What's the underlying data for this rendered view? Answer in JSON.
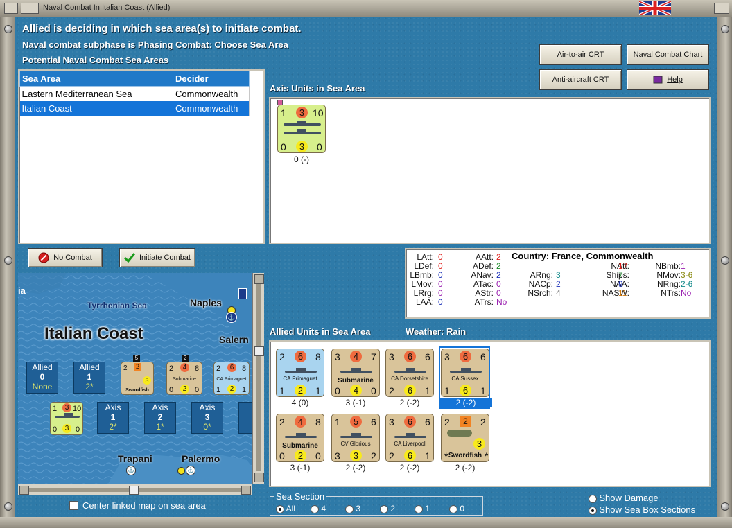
{
  "window": {
    "title": "Naval Combat In Italian Coast (Allied)"
  },
  "header": {
    "line1": "Allied is deciding in which sea area(s) to initiate combat.",
    "line2": "Naval combat subphase is Phasing Combat: Choose Sea Area",
    "line3": "Potential Naval Combat Sea Areas"
  },
  "buttons": {
    "air_to_air": "Air-to-air CRT",
    "naval_chart": "Naval Combat Chart",
    "anti_aircraft": "Anti-aircraft CRT",
    "help": "Help",
    "no_combat": "No Combat",
    "initiate_combat": "Initiate Combat"
  },
  "sea_table": {
    "headers": [
      "Sea Area",
      "Decider"
    ],
    "rows": [
      {
        "area": "Eastern Mediterranean Sea",
        "decider": "Commonwealth"
      },
      {
        "area": "Italian Coast",
        "decider": "Commonwealth"
      }
    ]
  },
  "axis": {
    "label": "Axis Units in Sea Area",
    "unit": {
      "tl": "1",
      "tc": "3",
      "tr": "10",
      "bl": "0",
      "bc": "3",
      "br": "0",
      "caption": "0 (-)"
    }
  },
  "stats": {
    "country": "Country: France, Commonwealth",
    "col1": [
      [
        "LAtt:",
        "0"
      ],
      [
        "LDef:",
        "0"
      ],
      [
        "LBmb:",
        "0"
      ],
      [
        "LMov:",
        "0"
      ],
      [
        "LRrg:",
        "0"
      ],
      [
        "LAA:",
        "0"
      ]
    ],
    "col2": [
      [
        "AAtt:",
        "2"
      ],
      [
        "ADef:",
        "2"
      ],
      [
        "ANav:",
        "2"
      ],
      [
        "ATac:",
        "0"
      ],
      [
        "AStr:",
        "0"
      ],
      [
        "ATrs:",
        "No"
      ]
    ],
    "col3": [
      [
        "ARng:",
        "3"
      ],
      [
        "NACp:",
        "2"
      ],
      [
        "NSrch:",
        "4"
      ]
    ],
    "col4": [
      [
        "NAtt:",
        "17"
      ],
      [
        "Ships:",
        "7"
      ],
      [
        "NAA:",
        "9"
      ],
      [
        "NASW:",
        "11"
      ]
    ],
    "col5": [
      [
        "NBmb:",
        "1"
      ],
      [
        "NMov:",
        "3-6"
      ],
      [
        "NRng:",
        "2-6"
      ],
      [
        "NTrs:",
        "No"
      ]
    ],
    "colors": {
      "red": "#e0201c",
      "blue": "#1a2fb8",
      "green": "#1b8a2a",
      "teal": "#138a8a",
      "purple": "#9a1fb0",
      "olive": "#8a8a10",
      "orange": "#d07a10",
      "gray": "#707070"
    }
  },
  "allied": {
    "label": "Allied Units in Sea Area",
    "weather": "Weather:  Rain",
    "units": [
      {
        "tl": "2",
        "tc": "6",
        "tr": "8",
        "name": "CA Primaguet",
        "bl": "1",
        "bc": "2",
        "br": "1",
        "caption": "4 (0)"
      },
      {
        "tl": "3",
        "tc": "4",
        "tr": "7",
        "name": "Submarine",
        "bl": "0",
        "bc": "4",
        "br": "0",
        "caption": "3 (-1)"
      },
      {
        "tl": "3",
        "tc": "6",
        "tr": "6",
        "name": "CA Dorsetshire",
        "bl": "2",
        "bc": "6",
        "br": "1",
        "caption": "2 (-2)"
      },
      {
        "tl": "3",
        "tc": "6",
        "tr": "6",
        "name": "CA Sussex",
        "bl": "1",
        "bc": "6",
        "br": "1",
        "caption": "2 (-2)"
      },
      {
        "tl": "2",
        "tc": "4",
        "tr": "8",
        "name": "Submarine",
        "bl": "0",
        "bc": "2",
        "br": "0",
        "caption": "3 (-1)"
      },
      {
        "tl": "1",
        "tc": "5",
        "tr": "6",
        "name": "CV Glorious",
        "bl": "3",
        "bc": "3",
        "br": "2",
        "caption": "2 (-2)"
      },
      {
        "tl": "3",
        "tc": "6",
        "tr": "6",
        "name": "CA Liverpool",
        "bl": "2",
        "bc": "6",
        "br": "1",
        "caption": "2 (-2)"
      },
      {
        "tl": "2",
        "tc": "2",
        "tr": "2",
        "name": "Swordfish",
        "bl": "*",
        "bc": "3",
        "br": "*",
        "caption": "2 (-2)"
      }
    ]
  },
  "map": {
    "title": "Italian Coast",
    "sea_name": "Tyrrhenian Sea",
    "cities": [
      "Naples",
      "Salern",
      "Trapani",
      "Palermo"
    ],
    "edge_label": "ia",
    "boxes_top": [
      {
        "side": "Allied",
        "n": "0",
        "sub": "None"
      },
      {
        "side": "Allied",
        "n": "1",
        "sub": "2*"
      }
    ],
    "boxes_bottom": [
      {
        "side": "Axis",
        "n": "1",
        "sub": "2*"
      },
      {
        "side": "Axis",
        "n": "2",
        "sub": "1*"
      },
      {
        "side": "Axis",
        "n": "3",
        "sub": "0*"
      },
      {
        "side": "A",
        "n": "",
        "sub": ""
      }
    ],
    "mini_units": [
      {
        "tl": "2",
        "tc": "2",
        "tr": "",
        "name": "Swordfish",
        "bc": "3",
        "badge": "5"
      },
      {
        "tl": "2",
        "tc": "4",
        "tr": "8",
        "name": "Submarine",
        "bl": "0",
        "bc": "2",
        "br": "0",
        "badge": "2"
      },
      {
        "tl": "2",
        "tc": "6",
        "tr": "8",
        "name": "CA Primaguet",
        "bl": "1",
        "bc": "2",
        "br": "1"
      }
    ],
    "axis_mini": {
      "tl": "1",
      "tc": "3",
      "tr": "10",
      "bl": "0",
      "bc": "3",
      "br": "0"
    }
  },
  "options": {
    "center_map": "Center linked map on sea area",
    "sea_section_label": "Sea Section",
    "sections": [
      "All",
      "4",
      "3",
      "2",
      "1",
      "0"
    ],
    "show_damage": "Show Damage",
    "show_sections": "Show Sea Box Sections"
  }
}
